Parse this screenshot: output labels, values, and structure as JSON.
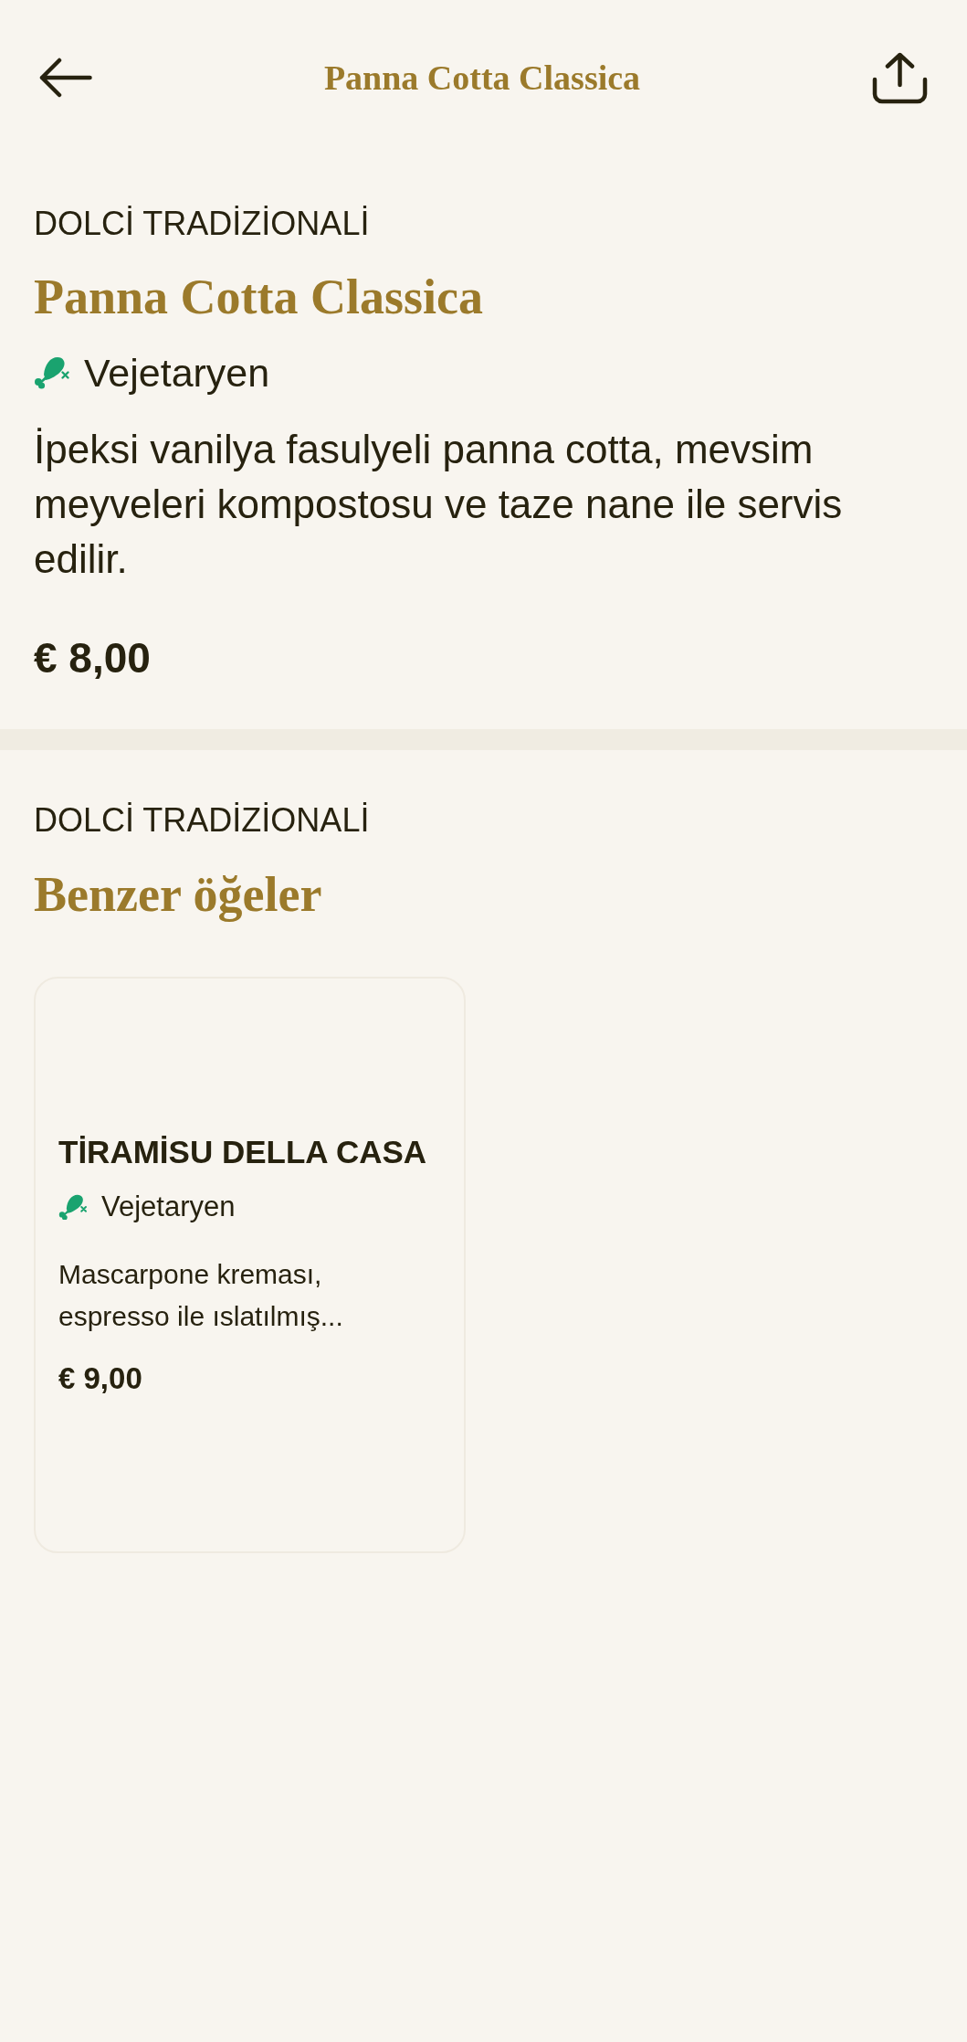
{
  "header": {
    "title": "Panna Cotta Classica"
  },
  "item": {
    "category": "DOLCİ TRADİZİONALİ",
    "name": "Panna Cotta Classica",
    "diet": "Vejetaryen",
    "description": "İpeksi vanilya fasulyeli panna cotta, mevsim meyveleri kompostosu ve taze nane ile servis edilir.",
    "price": "€ 8,00"
  },
  "similar": {
    "category": "DOLCİ TRADİZİONALİ",
    "title": "Benzer öğeler",
    "items": [
      {
        "name": "TİRAMİSU DELLA CASA",
        "diet": "Vejetaryen",
        "description": "Mascarpone kreması, espresso ile ıslatılmış...",
        "price": "€ 9,00"
      }
    ]
  }
}
